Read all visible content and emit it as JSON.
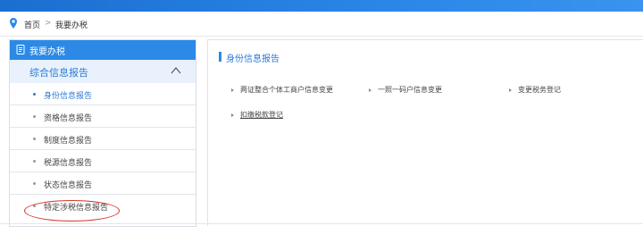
{
  "breadcrumb": {
    "home": "首页",
    "separator": ">",
    "current": "我要办税"
  },
  "sidebar": {
    "header": "我要办税",
    "section": "综合信息报告",
    "items": [
      {
        "label": "身份信息报告",
        "active": true
      },
      {
        "label": "资格信息报告",
        "active": false
      },
      {
        "label": "制度信息报告",
        "active": false
      },
      {
        "label": "税源信息报告",
        "active": false
      },
      {
        "label": "状态信息报告",
        "active": false
      },
      {
        "label": "特定涉税信息报告",
        "active": false,
        "circled": true
      }
    ]
  },
  "main": {
    "title": "身份信息报告",
    "links": [
      {
        "label": "两证整合个体工商户信息变更"
      },
      {
        "label": "一照一码户信息变更"
      },
      {
        "label": "变更税务登记"
      },
      {
        "label": "扣缴税款登记"
      }
    ]
  },
  "colors": {
    "accent": "#2c89e6",
    "active_text": "#2c79d6",
    "highlight_circle": "#d2352c"
  }
}
